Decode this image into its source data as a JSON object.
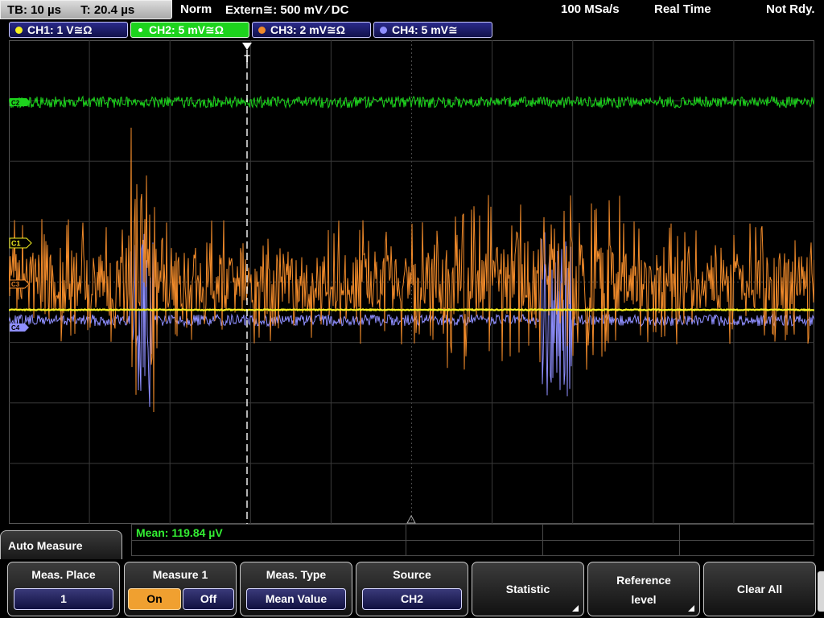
{
  "status": {
    "timebase": "TB: 10 µs",
    "trigger_pos": "T: 20.4 µs",
    "mode": "Norm",
    "trigger_source": "Extern≅: 500 mV ⁄ DC",
    "sample_rate": "100 MSa/s",
    "acq_mode": "Real Time",
    "ready_state": "Not Rdy."
  },
  "channels": [
    {
      "label": "CH1: 1 V≅Ω",
      "color": "#f5f020",
      "active": false
    },
    {
      "label": "CH2: 5 mV≅Ω",
      "color": "#1dd31d",
      "active": true
    },
    {
      "label": "CH3: 2 mV≅Ω",
      "color": "#f08a2a",
      "active": false
    },
    {
      "label": "CH4: 5 mV≅",
      "color": "#8f8fff",
      "active": false
    }
  ],
  "markers": {
    "ch2": "C2",
    "ch1": "C1",
    "ch3": "C3",
    "ch4": "C4",
    "trigger": "T"
  },
  "measurement": {
    "mean_readout": "Mean: 119.84 µV"
  },
  "menu": {
    "title": "Auto Measure",
    "meas_place": {
      "label": "Meas. Place",
      "value": "1"
    },
    "measure1": {
      "label": "Measure 1",
      "on": "On",
      "off": "Off",
      "state": "on"
    },
    "meas_type": {
      "label": "Meas. Type",
      "value": "Mean Value"
    },
    "source": {
      "label": "Source",
      "value": "CH2"
    },
    "statistic": {
      "label": "Statistic"
    },
    "reference_level": {
      "label1": "Reference",
      "label2": "level"
    },
    "clear_all": {
      "label": "Clear All"
    }
  }
}
